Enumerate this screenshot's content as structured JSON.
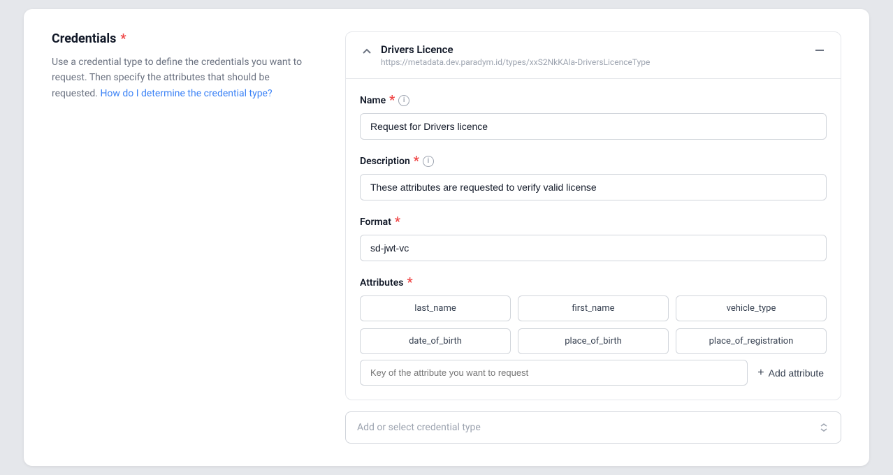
{
  "sidebar": {
    "title": "Credentials",
    "required_indicator": "*",
    "description_part1": "Use a credential type to define the credentials you want to request. Then specify the attributes that should be requested.",
    "link_text": "How do I determine the credential type?",
    "description_part2": ""
  },
  "credential_card": {
    "title": "Drivers Licence",
    "url": "https://metadata.dev.paradym.id/types/xxS2NkKAla-DriversLicenceType",
    "name_label": "Name",
    "name_required": "*",
    "name_value": "Request for Drivers licence",
    "description_label": "Description",
    "description_required": "*",
    "description_value": "These attributes are requested to verify valid license",
    "format_label": "Format",
    "format_required": "*",
    "format_value": "sd-jwt-vc",
    "attributes_label": "Attributes",
    "attributes_required": "*",
    "attributes": [
      "last_name",
      "first_name",
      "vehicle_type",
      "date_of_birth",
      "place_of_birth",
      "place_of_registration"
    ],
    "attribute_input_placeholder": "Key of the attribute you want to request",
    "add_attribute_label": "Add attribute"
  },
  "bottom_selector": {
    "placeholder": "Add or select credential type"
  },
  "icons": {
    "info": "i",
    "chevron_up": "˄",
    "minus": "—",
    "plus": "+",
    "arrows": "⇅"
  }
}
